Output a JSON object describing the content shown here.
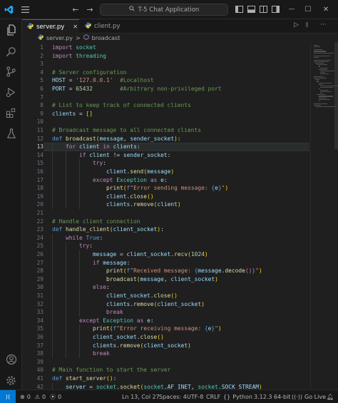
{
  "titlebar": {
    "search_text": "T-5 Chat Application",
    "nav_back": "←",
    "nav_forward": "→",
    "minimize": "—",
    "maximize": "☐",
    "close": "✕"
  },
  "tabs": [
    {
      "label": "server.py",
      "active": true
    },
    {
      "label": "client.py",
      "active": false
    }
  ],
  "tab_actions": {
    "run": "▷",
    "split": "⫾",
    "more": "···"
  },
  "breadcrumb": {
    "file": "server.py",
    "sep": ">",
    "symbol": "broadcast"
  },
  "editor": {
    "current_line": 13,
    "lines": [
      "<span class='kw'>import</span> <span class='cls'>socket</span>",
      "<span class='kw'>import</span> <span class='cls'>threading</span>",
      "",
      "<span class='cm'># Server configuration</span>",
      "<span class='var'>HOST</span> = <span class='str'>'127.0.0.1'</span>  <span class='cm'>#Localhost</span>",
      "<span class='var'>PORT</span> = <span class='num'>65432</span>        <span class='cm'>#Arbitrary non-privileged port</span>",
      "",
      "<span class='cm'># List to keep track of connected clients</span>",
      "<span class='var'>clients</span> = <span class='br'>[]</span>",
      "",
      "<span class='cm'># Broadcast message to all connected clients</span>",
      "<span class='kb'>def</span> <span class='fn'>broadcast</span><span class='br'>(</span><span class='var'>message</span>, <span class='var'>sender_socket</span><span class='br'>)</span>:",
      "    <span class='kw'>for</span> <span class='var'>client</span> <span class='kw'>in</span> <span class='var'>clients</span>:",
      "        <span class='kw'>if</span> <span class='var'>client</span> != <span class='var'>sender_socket</span>:",
      "            <span class='kw'>try</span>:",
      "                <span class='var'>client</span>.<span class='fn'>send</span><span class='br'>(</span><span class='var'>message</span><span class='br'>)</span>",
      "            <span class='kw'>except</span> <span class='cls'>Exception</span> <span class='kw'>as</span> <span class='var'>e</span>:",
      "                <span class='fn'>print</span><span class='br'>(</span><span class='kb'>f</span><span class='str'>\"Error sending message: </span><span class='kb'>{</span><span class='var'>e</span><span class='kb'>}</span><span class='str'>\"</span><span class='br'>)</span>",
      "                <span class='var'>client</span>.<span class='fn'>close</span><span class='br'>()</span>",
      "                <span class='var'>clients</span>.<span class='fn'>remove</span><span class='br'>(</span><span class='var'>client</span><span class='br'>)</span>",
      "",
      "<span class='cm'># Handle client connection</span>",
      "<span class='kb'>def</span> <span class='fn'>handle_client</span><span class='br'>(</span><span class='var'>client_socket</span><span class='br'>)</span>:",
      "    <span class='kw'>while</span> <span class='kb'>True</span>:",
      "        <span class='kw'>try</span>:",
      "            <span class='var'>message</span> = <span class='var'>client_socket</span>.<span class='fn'>recv</span><span class='br'>(</span><span class='num'>1024</span><span class='br'>)</span>",
      "            <span class='kw'>if</span> <span class='var'>message</span>:",
      "                <span class='fn'>print</span><span class='br'>(</span><span class='kb'>f</span><span class='str'>\"Received message: </span><span class='kb'>{</span><span class='var'>message</span>.<span class='fn'>decode</span><span class='br2'>()</span><span class='kb'>}</span><span class='str'>\"</span><span class='br'>)</span>",
      "                <span class='fn'>broadcast</span><span class='br'>(</span><span class='var'>message</span>, <span class='var'>client_socket</span><span class='br'>)</span>",
      "            <span class='kw'>else</span>:",
      "                <span class='var'>client_socket</span>.<span class='fn'>close</span><span class='br'>()</span>",
      "                <span class='var'>clients</span>.<span class='fn'>remove</span><span class='br'>(</span><span class='var'>client_socket</span><span class='br'>)</span>",
      "                <span class='kw'>break</span>",
      "        <span class='kw'>except</span> <span class='cls'>Exception</span> <span class='kw'>as</span> <span class='var'>e</span>:",
      "            <span class='fn'>print</span><span class='br'>(</span><span class='kb'>f</span><span class='str'>\"Error receiving message: </span><span class='kb'>{</span><span class='var'>e</span><span class='kb'>}</span><span class='str'>\"</span><span class='br'>)</span>",
      "            <span class='var'>client_socket</span>.<span class='fn'>close</span><span class='br'>()</span>",
      "            <span class='var'>clients</span>.<span class='fn'>remove</span><span class='br'>(</span><span class='var'>client_socket</span><span class='br'>)</span>",
      "            <span class='kw'>break</span>",
      "",
      "<span class='cm'># Main function to start the server</span>",
      "<span class='kb'>def</span> <span class='fn'>start_server</span><span class='br'>()</span>:",
      "    <span class='var'>server</span> = <span class='cls'>socket</span>.<span class='fn'>socket</span><span class='br'>(</span><span class='cls'>socket</span>.<span class='var'>AF_INET</span>, <span class='cls'>socket</span>.<span class='var'>SOCK_STREAM</span><span class='br'>)</span>"
    ]
  },
  "statusbar": {
    "remote": "⟩⟨",
    "errors": "0",
    "warnings": "0",
    "ports": "0",
    "position": "Ln 13, Col 27",
    "spaces": "Spaces: 4",
    "encoding": "UTF-8",
    "eol": "CRLF",
    "language": "Python",
    "interpreter": "3.12.3 64-bit",
    "golive": "Go Live"
  },
  "colors": {
    "accent": "#0078d4",
    "editor_bg": "#1f1f1f",
    "chrome_bg": "#181818"
  }
}
